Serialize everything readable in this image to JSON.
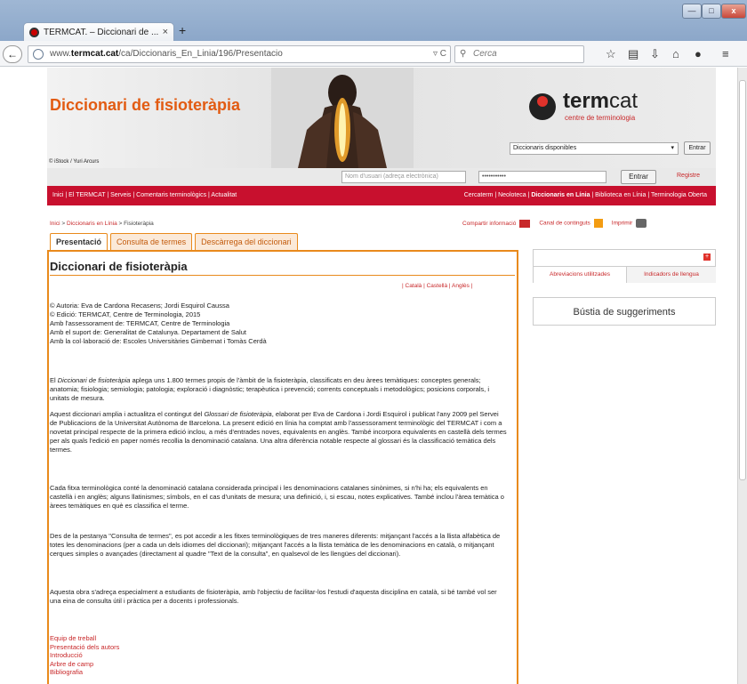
{
  "browser": {
    "tab_title": "TERMCAT. – Diccionari de ...",
    "tab_close": "×",
    "new_tab": "+",
    "url_prefix": "www.",
    "url_domain": "termcat.cat",
    "url_path": "/ca/Diccionaris_En_Linia/196/Presentacio",
    "search_placeholder": "Cerca",
    "window_min": "—",
    "window_max": "□",
    "window_close": "x"
  },
  "header": {
    "dictionary_title": "Diccionari de fisioteràpia",
    "photo_credit": "© iStock / Yuri Arcurs",
    "logo_term": "term",
    "logo_cat": "cat",
    "logo_subtitle": "centre de terminologia",
    "dict_select": "Diccionaris disponibles",
    "entrar_label": "Entrar"
  },
  "login": {
    "user_placeholder": "Nom d'usuari (adreça electrònica)",
    "password_value": "•••••••••••",
    "submit_label": "Entrar",
    "register_label": "Registre"
  },
  "menu": {
    "left": "Inici | El TERMCAT | Serveis | Comentaris terminològics | Actualitat",
    "right_a": "Cercaterm | Neoloteca | ",
    "right_b": "Diccionaris en Línia",
    "right_c": " | Biblioteca en Línia | Terminologia Oberta"
  },
  "breadcrumb": {
    "home": "Inici",
    "sep": " > ",
    "section": "Diccionaris en Línia",
    "current": "Fisioteràpia"
  },
  "tools": {
    "share": "Compartir informació",
    "feed": "Canal de continguts",
    "print": "Imprimir"
  },
  "tabs": [
    {
      "label": "Presentació",
      "active": true
    },
    {
      "label": "Consulta de termes",
      "active": false
    },
    {
      "label": "Descàrrega del diccionari",
      "active": false
    }
  ],
  "main": {
    "title": "Diccionari de fisioteràpia",
    "languages": "| Català | Castellà | Anglès |",
    "credits": [
      "© Autoria: Eva de Cardona Recasens; Jordi Esquirol Caussa",
      "© Edició: TERMCAT, Centre de Terminologia, 2015",
      "Amb l'assessorament de: TERMCAT, Centre de Terminologia",
      "Amb el suport de: Generalitat de Catalunya. Departament de Salut",
      "Amb la col·laboració de: Escoles Universitàries Gimbernat i Tomàs Cerdà"
    ],
    "p1_a": "El ",
    "p1_em": "Diccionari de fisioteràpia",
    "p1_b": " aplega uns 1.800 termes propis de l'àmbit de la fisioteràpia, classificats en deu àrees temàtiques: conceptes generals; anatomia; fisiologia; semiologia; patologia; exploració i diagnòstic; terapèutica i prevenció; corrents conceptuals i metodològics; posicions corporals, i unitats de mesura.",
    "p2_a": "Aquest diccionari amplia i actualitza el contingut del ",
    "p2_em": "Glossari de fisioteràpia",
    "p2_b": ", elaborat per Eva de Cardona i Jordi Esquirol i publicat l'any 2009 pel Servei de Publicacions de la Universitat Autònoma de Barcelona. La present edició en línia ha comptat amb l'assessorament terminològic del TERMCAT i com a novetat principal respecte de la primera edició inclou, a més d'entrades noves, equivalents en anglès. També incorpora equivalents en castellà dels termes per als quals l'edició en paper només recollia la denominació catalana. Una altra diferència notable respecte al glossari és la classificació temàtica dels termes.",
    "p3": "Cada fitxa terminològica conté la denominació catalana considerada principal i les denominacions catalanes sinònimes, si n'hi ha; els equivalents en castellà i en anglès; alguns llatinismes; símbols, en el cas d'unitats de mesura; una definició, i, si escau, notes explicatives. També inclou l'àrea temàtica o àrees temàtiques en què es classifica el terme.",
    "p4": "Des de la pestanya \"Consulta de termes\", es pot accedir a les fitxes terminològiques de tres maneres diferents: mitjançant l'accés a la llista alfabètica de totes les denominacions (per a cada un dels idiomes del diccionari); mitjançant l'accés a la llista temàtica de les denominacions en català, o mitjançant cerques simples o avançades (directament al quadre \"Text de la consulta\", en qualsevol de les llengües del diccionari).",
    "p5": "Aquesta obra s'adreça especialment a estudiants de fisioteràpia, amb l'objectiu de facilitar-los l'estudi d'aquesta disciplina en català, si bé també vol ser una eina de consulta útil i pràctica per a docents i professionals.",
    "links": [
      "Equip de treball",
      "Presentació dels autors",
      "Introducció",
      "Arbre de camp",
      "Bibliografia"
    ]
  },
  "sidebar": {
    "plus": "+",
    "tab1": "Abreviacions utilitzades",
    "tab2": "Indicadors de llengua",
    "suggestions": "Bústia de suggeriments"
  }
}
